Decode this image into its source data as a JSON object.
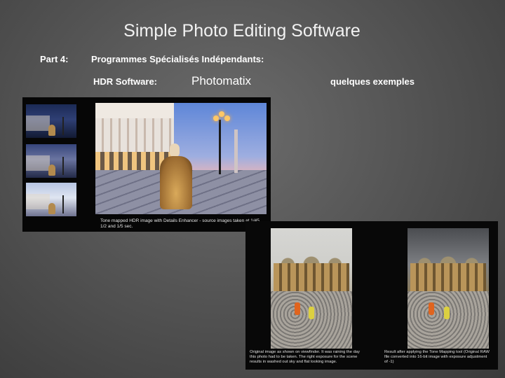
{
  "slide": {
    "title": "Simple Photo Editing Software",
    "part_label": "Part 4:",
    "part_text": "Programmes Spécialisés Indépendants:",
    "hdr_label": "HDR Software:",
    "product": "Photomatix",
    "examples": "quelques exemples"
  },
  "panel1": {
    "caption": "Tone mapped HDR image with Details Enhancer - source images taken at 1/45, 1/2 and 1/5 sec."
  },
  "panel2": {
    "caption_left": "Original image as shown on viewfinder. It was raining the day this photo had to be taken. The right exposure for the scene results in washed out sky and flat looking image.",
    "caption_right": "Result after applying the Tone Mapping tool (Original RAW file converted into 16-bit image with exposure adjustment of -1)"
  },
  "colors": {
    "background": "#555555",
    "panel": "#060606",
    "text": "#ffffff"
  }
}
